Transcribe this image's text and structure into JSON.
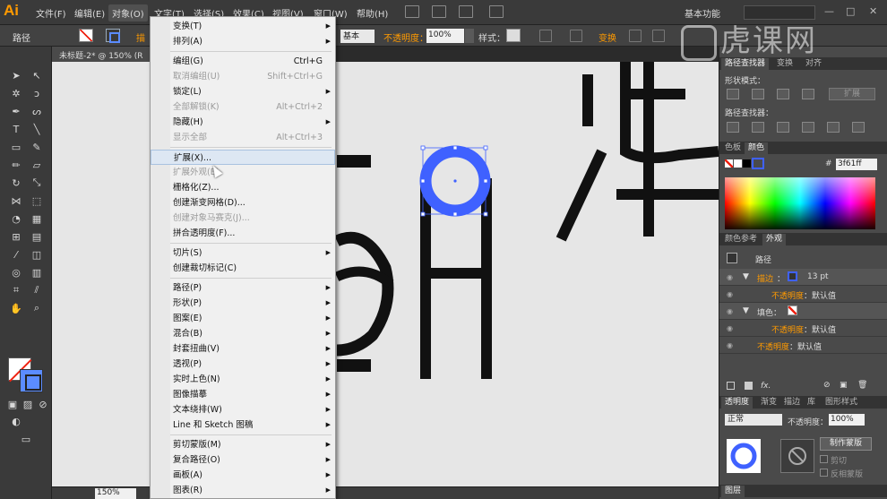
{
  "app": {
    "logo": "Ai"
  },
  "menubar": {
    "items": [
      "文件(F)",
      "编辑(E)",
      "对象(O)",
      "文字(T)",
      "选择(S)",
      "效果(C)",
      "视图(V)",
      "窗口(W)",
      "帮助(H)"
    ],
    "workspace": "基本功能",
    "window_controls": [
      "—",
      "□",
      "✕"
    ]
  },
  "watermark": {
    "text": "虎课网"
  },
  "controlbar": {
    "selection_label": "路径",
    "stroke_word": "描",
    "profile_value": "基本",
    "opacity_label": "不透明度：",
    "opacity_value": "100%",
    "style_label": "样式：",
    "transform_label": "变换"
  },
  "document": {
    "tab_title": "未标题-2* @ 150% (R",
    "zoom": "150%"
  },
  "object_menu": {
    "items": [
      {
        "label": "变换(T)",
        "submenu": true,
        "disabled": false
      },
      {
        "label": "排列(A)",
        "submenu": true,
        "disabled": false
      },
      {
        "label": "编组(G)",
        "shortcut": "Ctrl+G",
        "disabled": false
      },
      {
        "label": "取消编组(U)",
        "shortcut": "Shift+Ctrl+G",
        "disabled": true
      },
      {
        "label": "锁定(L)",
        "submenu": true,
        "disabled": false
      },
      {
        "label": "全部解锁(K)",
        "shortcut": "Alt+Ctrl+2",
        "disabled": true
      },
      {
        "label": "隐藏(H)",
        "submenu": true,
        "disabled": false
      },
      {
        "label": "显示全部",
        "shortcut": "Alt+Ctrl+3",
        "disabled": true
      },
      {
        "label": "扩展(X)...",
        "disabled": false,
        "hover": true
      },
      {
        "label": "扩展外观(E)",
        "disabled": true
      },
      {
        "label": "栅格化(Z)...",
        "disabled": false
      },
      {
        "label": "创建渐变网格(D)...",
        "disabled": false
      },
      {
        "label": "创建对象马赛克(J)...",
        "disabled": true
      },
      {
        "label": "拼合透明度(F)...",
        "disabled": false
      },
      {
        "label": "切片(S)",
        "submenu": true,
        "disabled": false
      },
      {
        "label": "创建裁切标记(C)",
        "disabled": false
      },
      {
        "label": "路径(P)",
        "submenu": true,
        "disabled": false
      },
      {
        "label": "形状(P)",
        "submenu": true,
        "disabled": false
      },
      {
        "label": "图案(E)",
        "submenu": true,
        "disabled": false
      },
      {
        "label": "混合(B)",
        "submenu": true,
        "disabled": false
      },
      {
        "label": "封套扭曲(V)",
        "submenu": true,
        "disabled": false
      },
      {
        "label": "透视(P)",
        "submenu": true,
        "disabled": false
      },
      {
        "label": "实时上色(N)",
        "submenu": true,
        "disabled": false
      },
      {
        "label": "图像描摹",
        "submenu": true,
        "disabled": false
      },
      {
        "label": "文本绕排(W)",
        "submenu": true,
        "disabled": false
      },
      {
        "label": "Line 和 Sketch 图稿",
        "submenu": true,
        "disabled": false
      },
      {
        "label": "剪切蒙版(M)",
        "submenu": true,
        "disabled": false
      },
      {
        "label": "复合路径(O)",
        "submenu": true,
        "disabled": false
      },
      {
        "label": "画板(A)",
        "submenu": true,
        "disabled": false
      },
      {
        "label": "图表(R)",
        "submenu": true,
        "disabled": false
      }
    ]
  },
  "pathfinder_panel": {
    "tabs": [
      "路径查找器",
      "变换",
      "对齐"
    ],
    "shape_modes_label": "形状模式：",
    "expand_label": "扩展",
    "pathfinders_label": "路径查找器："
  },
  "color_panel": {
    "tabs": [
      "色板",
      "颜色"
    ],
    "hex_value": "3f61ff"
  },
  "appearance_panel": {
    "tabs": [
      "颜色参考",
      "外观"
    ],
    "title": "路径",
    "stroke_label": "描边",
    "stroke_colon": "：",
    "stroke_weight": "13 pt",
    "stroke_opacity_label": "不透明度",
    "stroke_opacity_value": "：默认值",
    "fill_label": "填色：",
    "fill_opacity_label": "不透明度",
    "fill_opacity_value": "：默认值",
    "opacity_label": "不透明度",
    "opacity_value": "：默认值",
    "fx_label": "fx."
  },
  "transparency_panel": {
    "tabs": [
      "透明度",
      "渐变",
      "描边",
      "库",
      "图形样式"
    ],
    "blend_mode": "正常",
    "opacity_label": "不透明度：",
    "opacity_value": "100%",
    "make_mask_label": "制作蒙版",
    "clip_label": "剪切",
    "invert_label": "反相蒙版"
  },
  "layers_panel": {
    "tab": "图层"
  },
  "colors": {
    "accent_blue": "#3f61ff",
    "highlight_orange": "#ff9a00",
    "menu_bg": "#f0f0f0",
    "canvas_bg": "#e6e6e6"
  }
}
